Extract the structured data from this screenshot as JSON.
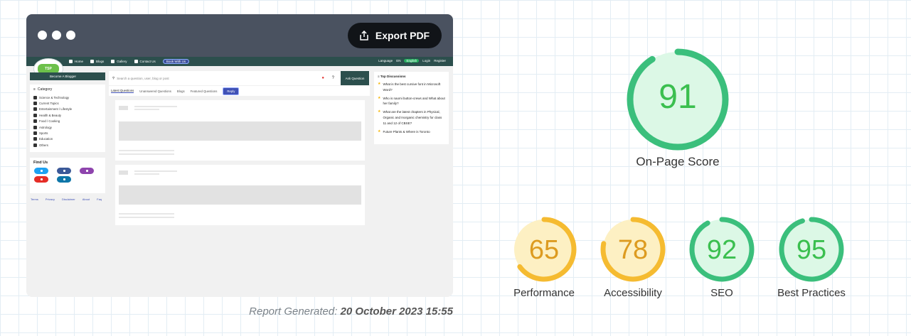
{
  "toolbar": {
    "export_label": "Export PDF"
  },
  "site": {
    "logo_text": "TSP",
    "nav": [
      "Home",
      "Blogs",
      "Gallery",
      "Contact Us"
    ],
    "nav_pill": "Book With Us",
    "language_label": "Language",
    "lang_code": "EN",
    "lang_pill": "English",
    "login": "Login",
    "register": "Register",
    "become_blogger": "Become A Blogger",
    "category_title": "Category",
    "categories": [
      "Science & Technology",
      "Current Topics",
      "Entertainment / Lifestyle",
      "Health & Beauty",
      "Food / Cooking",
      "Astrology",
      "Sports",
      "Education",
      "Others"
    ],
    "find_us": "Find Us",
    "footer_links": [
      "Terms",
      "Privacy",
      "Disclaimer",
      "About",
      "Faq"
    ],
    "search_placeholder": "Search a question, user, blog or post",
    "ask_button": "Ask Question",
    "tabs": [
      "Latest Questions",
      "Unanswered Questions",
      "Blogs",
      "Featured Questions"
    ],
    "tab_reply": "Reply",
    "top_discussions_title": "Top Discussions",
    "discussions": [
      "What is the best cursive font in Microsoft Word?",
      "Who is naomi button-crews and What about her family?",
      "What are the latest chapters in Physical, Organic and Inorganic chemistry for class 11 and 12 of CBSE?",
      "Future Plants & Where is Toronto"
    ]
  },
  "scores": {
    "main": {
      "value": 91,
      "label": "On-Page Score",
      "color": "#3bbf7c",
      "fill": "#dcf8e6",
      "text_color": "#3bbf4f"
    },
    "items": [
      {
        "value": 65,
        "label": "Performance",
        "color": "#f5bb31",
        "fill": "#fdf0c3",
        "text_color": "#dd9b20"
      },
      {
        "value": 78,
        "label": "Accessibility",
        "color": "#f5bb31",
        "fill": "#fdf0c3",
        "text_color": "#dd9b20"
      },
      {
        "value": 92,
        "label": "SEO",
        "color": "#3bbf7c",
        "fill": "#dcf8e6",
        "text_color": "#3bbf4f"
      },
      {
        "value": 95,
        "label": "Best Practices",
        "color": "#3bbf7c",
        "fill": "#dcf8e6",
        "text_color": "#3bbf4f"
      }
    ]
  },
  "report": {
    "prefix": "Report Generated:",
    "date": "20 October 2023 15:55"
  }
}
